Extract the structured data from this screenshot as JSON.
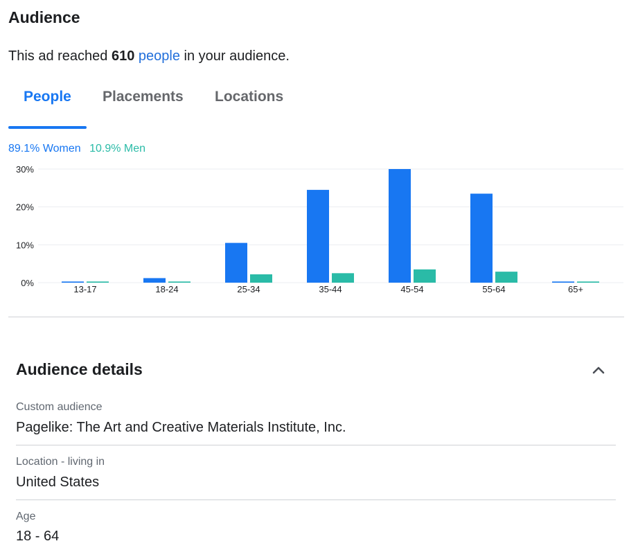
{
  "audience": {
    "title": "Audience",
    "reach_prefix": "This ad reached",
    "reach_count": "610",
    "reach_link": "people",
    "reach_suffix": "in your audience."
  },
  "tabs": [
    {
      "label": "People",
      "active": true
    },
    {
      "label": "Placements",
      "active": false
    },
    {
      "label": "Locations",
      "active": false
    }
  ],
  "legend": {
    "women": "89.1% Women",
    "men": "10.9% Men"
  },
  "colors": {
    "accent": "#1877f2",
    "women": "#1877f2",
    "men": "#2abba7"
  },
  "chart_data": {
    "type": "bar",
    "categories": [
      "13-17",
      "18-24",
      "25-34",
      "35-44",
      "45-54",
      "55-64",
      "65+"
    ],
    "series": [
      {
        "name": "Women",
        "values": [
          0.3,
          1.2,
          10.5,
          24.5,
          30.0,
          23.5,
          0.3
        ]
      },
      {
        "name": "Men",
        "values": [
          0.3,
          0.3,
          2.2,
          2.5,
          3.5,
          2.9,
          0.3
        ]
      }
    ],
    "yticks": [
      "0%",
      "10%",
      "20%",
      "30%"
    ],
    "ylim": [
      0,
      30
    ],
    "grid": true
  },
  "details": {
    "title": "Audience details",
    "collapse_icon": "chevron-up-icon",
    "items": [
      {
        "label": "Custom audience",
        "value": "Pagelike: The Art and Creative Materials Institute, Inc."
      },
      {
        "label": "Location - living in",
        "value": "United States"
      },
      {
        "label": "Age",
        "value": "18 - 64"
      }
    ]
  }
}
